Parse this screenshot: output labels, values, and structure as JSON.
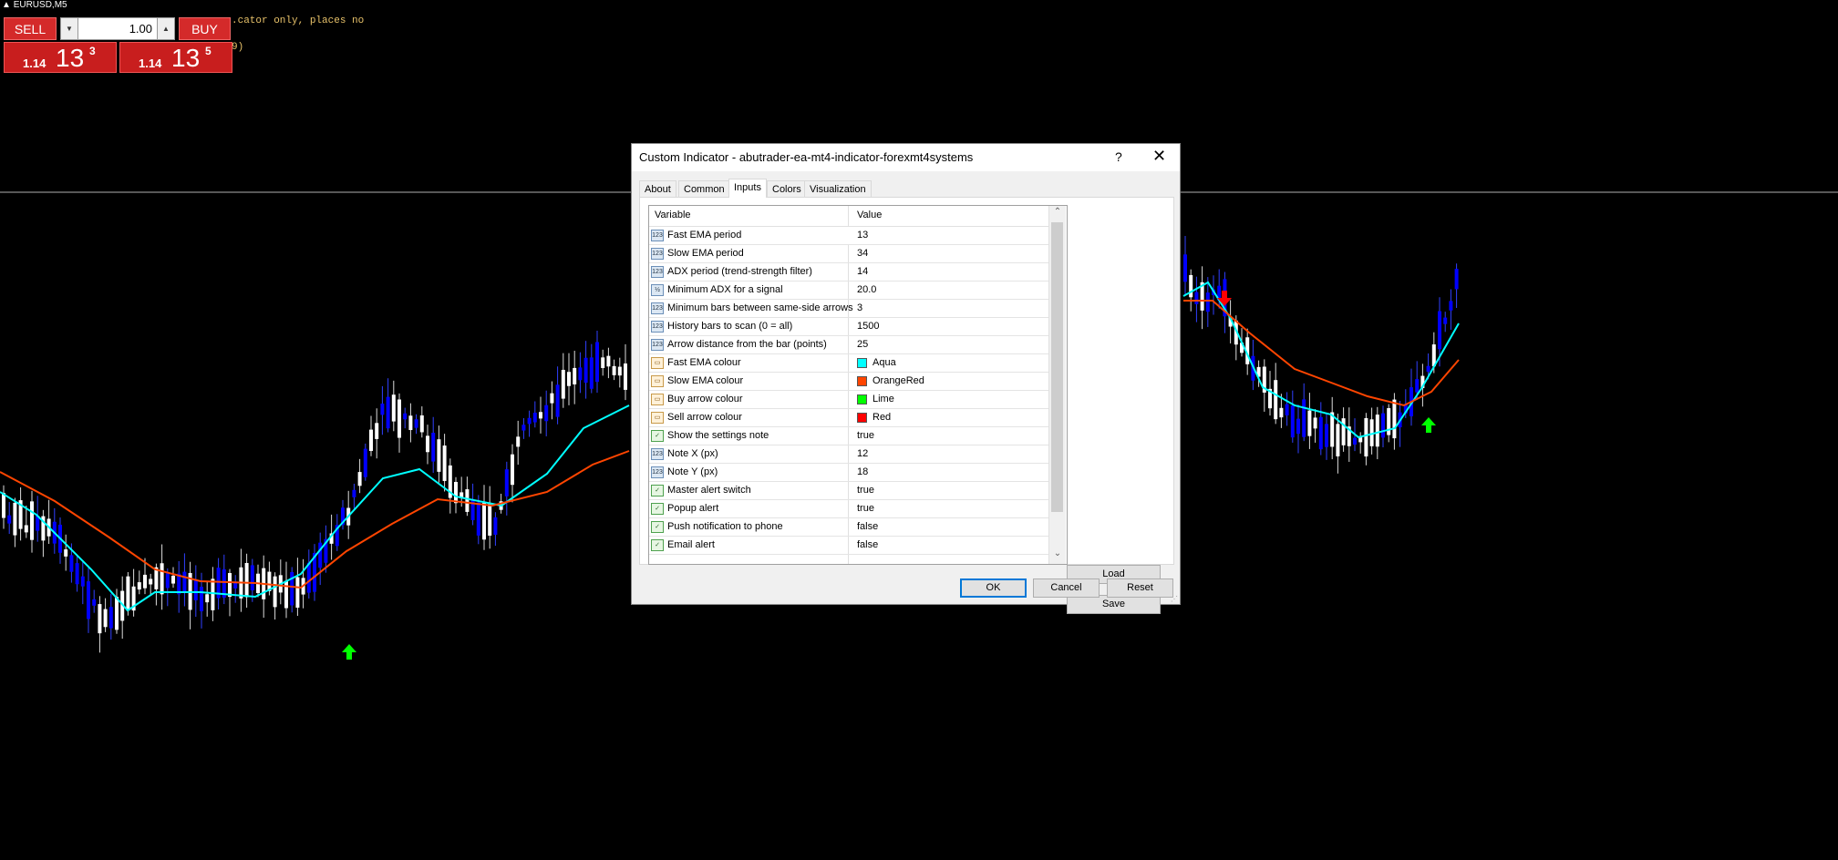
{
  "symbol": "EURUSD,M5",
  "notes": [
    ".cator only, places no",
    "9)"
  ],
  "trade_panel": {
    "sell_label": "SELL",
    "buy_label": "BUY",
    "lots": "1.00",
    "bid": {
      "small": "1.14",
      "big": "13",
      "sup": "3"
    },
    "ask": {
      "small": "1.14",
      "big": "13",
      "sup": "5"
    }
  },
  "dialog": {
    "title": "Custom Indicator - abutrader-ea-mt4-indicator-forexmt4systems",
    "help": "?",
    "close": "✕",
    "tabs": [
      {
        "label": "About"
      },
      {
        "label": "Common"
      },
      {
        "label": "Inputs"
      },
      {
        "label": "Colors"
      },
      {
        "label": "Visualization"
      }
    ],
    "active_tab": "Inputs",
    "grid": {
      "col_variable": "Variable",
      "col_value": "Value",
      "rows": [
        {
          "type": "int",
          "icon": "123",
          "name": "Fast EMA period",
          "value": "13"
        },
        {
          "type": "int",
          "icon": "123",
          "name": "Slow EMA period",
          "value": "34"
        },
        {
          "type": "int",
          "icon": "123",
          "name": "ADX period (trend-strength filter)",
          "value": "14"
        },
        {
          "type": "dbl",
          "icon": "½",
          "name": "Minimum ADX for a signal",
          "value": "20.0"
        },
        {
          "type": "int",
          "icon": "123",
          "name": "Minimum bars between same-side arrows",
          "value": "3"
        },
        {
          "type": "int",
          "icon": "123",
          "name": "History bars to scan (0 = all)",
          "value": "1500"
        },
        {
          "type": "int",
          "icon": "123",
          "name": "Arrow distance from the bar (points)",
          "value": "25"
        },
        {
          "type": "color",
          "icon": "▭",
          "name": "Fast EMA colour",
          "value": "Aqua",
          "swatch": "#00ffff"
        },
        {
          "type": "color",
          "icon": "▭",
          "name": "Slow EMA colour",
          "value": "OrangeRed",
          "swatch": "#ff4500"
        },
        {
          "type": "color",
          "icon": "▭",
          "name": "Buy arrow colour",
          "value": "Lime",
          "swatch": "#00ff00"
        },
        {
          "type": "color",
          "icon": "▭",
          "name": "Sell arrow colour",
          "value": "Red",
          "swatch": "#ff0000"
        },
        {
          "type": "bool",
          "icon": "✓",
          "name": "Show the settings note",
          "value": "true"
        },
        {
          "type": "int",
          "icon": "123",
          "name": "Note X (px)",
          "value": "12"
        },
        {
          "type": "int",
          "icon": "123",
          "name": "Note Y (px)",
          "value": "18"
        },
        {
          "type": "bool",
          "icon": "✓",
          "name": "Master alert switch",
          "value": "true"
        },
        {
          "type": "bool",
          "icon": "✓",
          "name": "Popup alert",
          "value": "true"
        },
        {
          "type": "bool",
          "icon": "✓",
          "name": "Push notification to phone",
          "value": "false"
        },
        {
          "type": "bool",
          "icon": "✓",
          "name": "Email alert",
          "value": "false"
        }
      ]
    },
    "load_label": "Load",
    "save_label": "Save",
    "ok_label": "OK",
    "cancel_label": "Cancel",
    "reset_label": "Reset"
  },
  "colors": {
    "fast_ema": "#00ffff",
    "slow_ema": "#ff4500",
    "bull_candle": "#0000ff",
    "bear_candle": "#ffffff",
    "buy_arrow": "#00ff00",
    "sell_arrow": "#ff0000"
  }
}
